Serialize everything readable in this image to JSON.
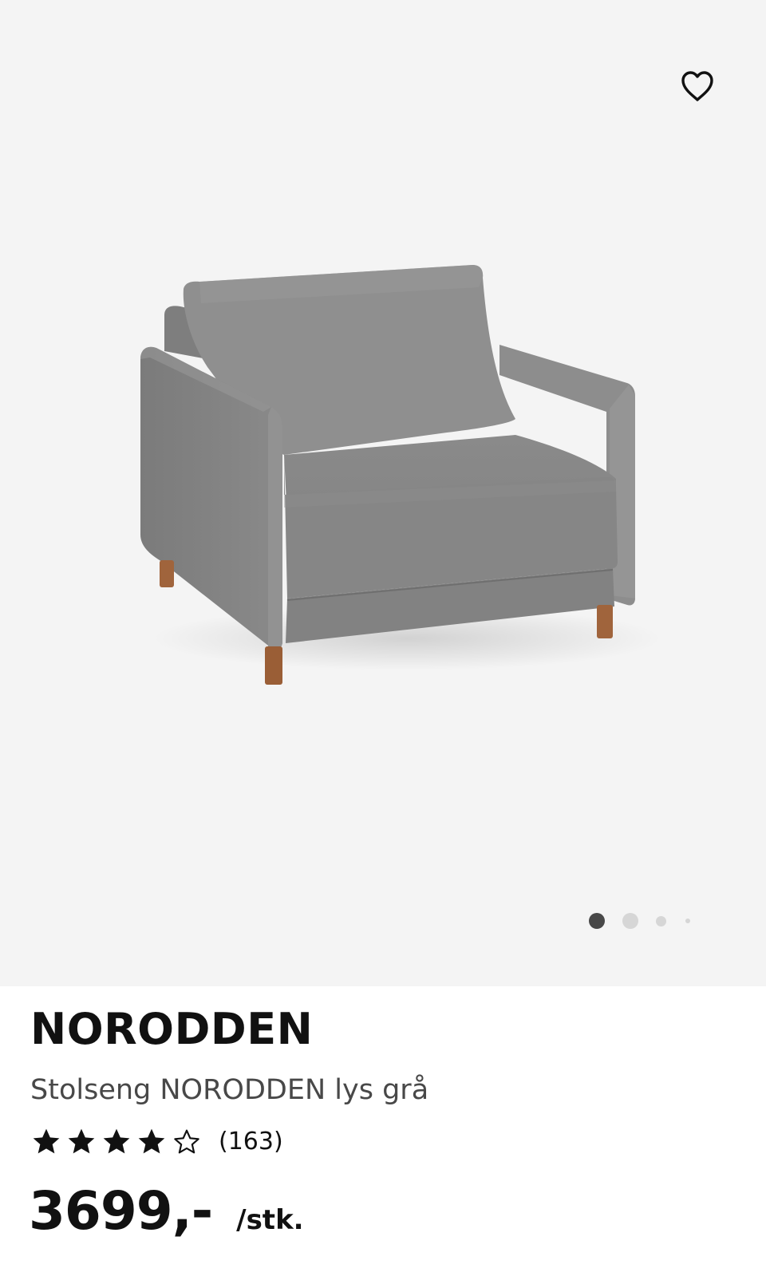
{
  "product": {
    "name": "NORODDEN",
    "description": "Stolseng NORODDEN lys grå",
    "rating": 4,
    "rating_max": 5,
    "review_count": "(163)",
    "price": "3699,-",
    "unit": "/stk."
  },
  "gallery": {
    "image": "grey-armchair-bed",
    "image_count": 4,
    "active_index": 0
  },
  "icons": {
    "favorite": "heart-outline-icon",
    "star_filled": "star-filled-icon",
    "star_empty": "star-outline-icon"
  },
  "colors": {
    "gallery_background": "#f4f4f4",
    "text": "#111111",
    "fabric": "#8c8c8c",
    "legs": "#a0643c",
    "active_dot": "#484848",
    "inactive_dot": "#d6d6d6"
  }
}
